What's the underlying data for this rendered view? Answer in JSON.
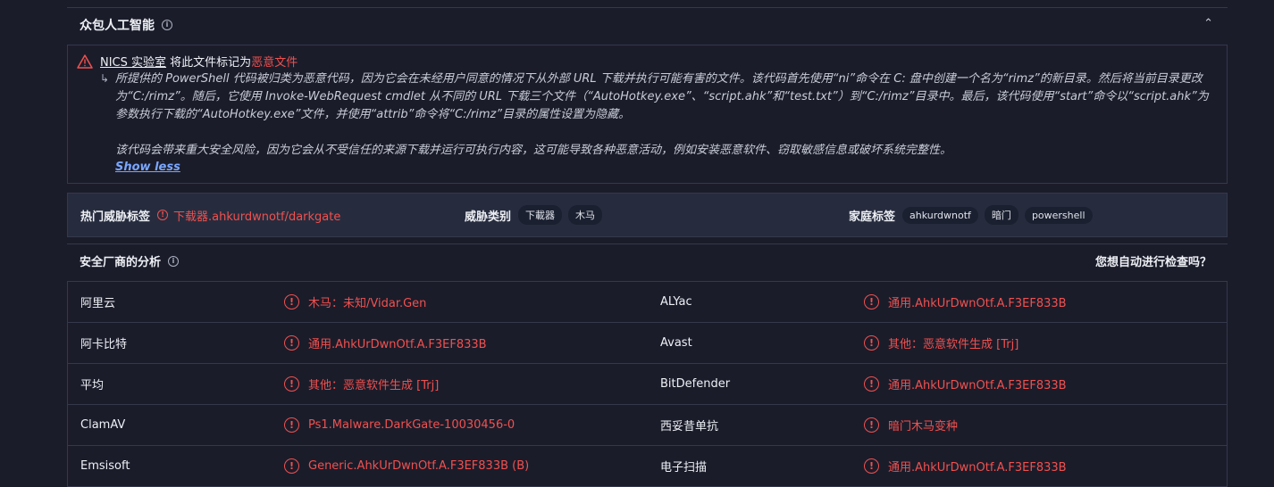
{
  "header": {
    "title": "众包人工智能",
    "info_icon": "info-icon",
    "chevron": "chevron-up-icon"
  },
  "ai_box": {
    "source": "NICS 实验室",
    "verdict_prefix": "将此文件标记为",
    "verdict": "恶意文件",
    "paragraph1": "所提供的 PowerShell 代码被归类为恶意代码，因为它会在未经用户同意的情况下从外部 URL 下载并执行可能有害的文件。该代码首先使用“ni”命令在 C: 盘中创建一个名为“rimz”的新目录。然后将当前目录更改为“C:/rimz”。随后，它使用 Invoke-WebRequest cmdlet 从不同的 URL 下载三个文件（“AutoHotkey.exe”、“script.ahk”和“test.txt”）到“C:/rimz”目录中。最后，该代码使用“start”命令以“script.ahk”为参数执行下载的“AutoHotkey.exe”文件，并使用“attrib”命令将“C:/rimz”目录的属性设置为隐藏。",
    "paragraph2": "该代码会带来重大安全风险，因为它会从不受信任的来源下载并运行可执行内容，这可能导致各种恶意活动，例如安装恶意软件、窃取敏感信息或破坏系统完整性。",
    "show_less": "Show less",
    "reply_arrow": "↳"
  },
  "tags": {
    "popular_label": "热门威胁标签",
    "popular_value": "下载器.ahkurdwnotf/darkgate",
    "category_label": "威胁类别",
    "categories": [
      "下載器",
      "木马"
    ],
    "family_label": "家庭标签",
    "families": [
      "ahkurdwnotf",
      "暗门",
      "powershell"
    ]
  },
  "vendors": {
    "title": "安全厂商的分析",
    "question": "您想自动进行检查吗？",
    "rows": [
      {
        "v1": "阿里云",
        "r1": "木马：未知/Vidar.Gen",
        "v2": "ALYac",
        "r2": "通用.AhkUrDwnOtf.A.F3EF833B"
      },
      {
        "v1": "阿卡比特",
        "r1": "通用.AhkUrDwnOtf.A.F3EF833B",
        "v2": "Avast",
        "r2": "其他：恶意软件生成 [Trj]"
      },
      {
        "v1": "平均",
        "r1": "其他：恶意软件生成 [Trj]",
        "v2": "BitDefender",
        "r2": "通用.AhkUrDwnOtf.A.F3EF833B"
      },
      {
        "v1": "ClamAV",
        "r1": "Ps1.Malware.DarkGate-10030456-0",
        "v2": "西妥昔单抗",
        "r2": "暗门木马变种"
      },
      {
        "v1": "Emsisoft",
        "r1": "Generic.AhkUrDwnOtf.A.F3EF833B (B)",
        "v2": "电子扫描",
        "r2": "通用.AhkUrDwnOtf.A.F3EF833B"
      }
    ]
  },
  "colors": {
    "malicious": "#f0514f",
    "link": "#7aa7ff",
    "background": "#1b1c2a"
  }
}
